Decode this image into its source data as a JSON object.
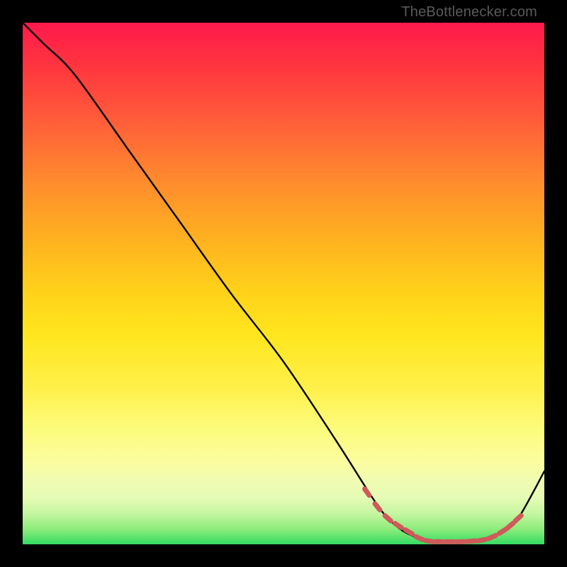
{
  "watermark": "TheBottlenecker.com",
  "gradient_colors": [
    "#ff1a4d",
    "#ff3040",
    "#ff5a3a",
    "#ff8a2e",
    "#ffb31f",
    "#ffd31a",
    "#ffe61e",
    "#fff04a",
    "#fcfc7d",
    "#fbfd9e",
    "#f0fbb2",
    "#e6fbb5",
    "#c7f6a2",
    "#8eec7c",
    "#35dc63"
  ],
  "chart_data": {
    "type": "line",
    "title": "",
    "xlabel": "",
    "ylabel": "",
    "xlim": [
      0,
      100
    ],
    "ylim": [
      0,
      100
    ],
    "series": [
      {
        "name": "curve",
        "x": [
          0,
          4,
          10,
          20,
          30,
          40,
          50,
          60,
          67,
          70,
          73,
          76,
          80,
          84,
          88,
          92,
          95,
          100
        ],
        "y": [
          100,
          96,
          90,
          76,
          62,
          48,
          35,
          20,
          9,
          5,
          2.5,
          1.2,
          0.5,
          0.5,
          0.8,
          2.5,
          5,
          14
        ]
      }
    ],
    "markers": {
      "name": "dashed-segment",
      "x": [
        66,
        68,
        70,
        72,
        74,
        76,
        78,
        80,
        82,
        84,
        86,
        88,
        90,
        92,
        93.5,
        95
      ],
      "y": [
        10,
        7.2,
        5,
        3.6,
        2.4,
        1.2,
        0.6,
        0.5,
        0.5,
        0.5,
        0.6,
        0.8,
        1.4,
        2.5,
        3.6,
        5
      ]
    }
  }
}
